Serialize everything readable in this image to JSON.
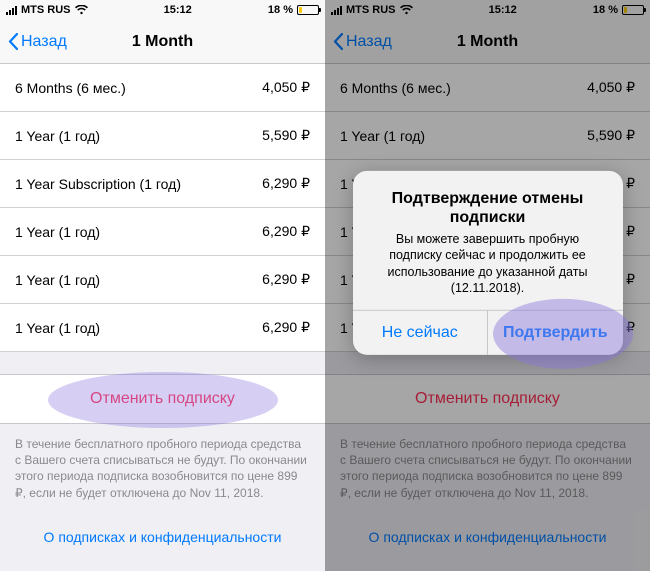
{
  "status": {
    "carrier": "MTS RUS",
    "time": "15:12",
    "battery_pct": "18 %"
  },
  "nav": {
    "back": "Назад",
    "title": "1 Month"
  },
  "subs": [
    {
      "label": "6 Months (6 мес.)",
      "price": "4,050 ₽"
    },
    {
      "label": "1 Year (1 год)",
      "price": "5,590 ₽"
    },
    {
      "label": "1 Year Subscription (1 год)",
      "price": "6,290 ₽"
    },
    {
      "label": "1 Year (1 год)",
      "price": "6,290 ₽"
    },
    {
      "label": "1 Year (1 год)",
      "price": "6,290 ₽"
    },
    {
      "label": "1 Year (1 год)",
      "price": "6,290 ₽"
    }
  ],
  "cancel_label": "Отменить подписку",
  "footer_text": "В течение бесплатного пробного периода средства с Вашего счета списываться не будут. По окончании этого периода подписка возобновится по цене 899 ₽, если не будет отключена до Nov 11, 2018.",
  "footer_link": "О подписках и конфиденциальности",
  "alert": {
    "title": "Подтверждение отмены подписки",
    "message": "Вы можете завершить пробную подписку сейчас и продолжить ее использование до указанной даты (12.11.2018).",
    "not_now": "Не сейчас",
    "confirm": "Подтвердить"
  }
}
